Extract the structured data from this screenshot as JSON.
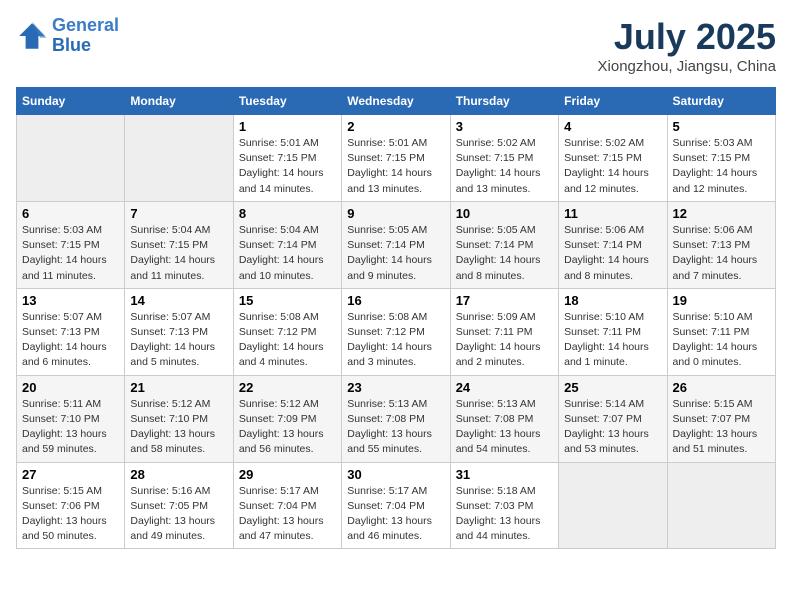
{
  "header": {
    "logo_line1": "General",
    "logo_line2": "Blue",
    "month": "July 2025",
    "location": "Xiongzhou, Jiangsu, China"
  },
  "weekdays": [
    "Sunday",
    "Monday",
    "Tuesday",
    "Wednesday",
    "Thursday",
    "Friday",
    "Saturday"
  ],
  "weeks": [
    [
      {
        "day": "",
        "info": ""
      },
      {
        "day": "",
        "info": ""
      },
      {
        "day": "1",
        "info": "Sunrise: 5:01 AM\nSunset: 7:15 PM\nDaylight: 14 hours\nand 14 minutes."
      },
      {
        "day": "2",
        "info": "Sunrise: 5:01 AM\nSunset: 7:15 PM\nDaylight: 14 hours\nand 13 minutes."
      },
      {
        "day": "3",
        "info": "Sunrise: 5:02 AM\nSunset: 7:15 PM\nDaylight: 14 hours\nand 13 minutes."
      },
      {
        "day": "4",
        "info": "Sunrise: 5:02 AM\nSunset: 7:15 PM\nDaylight: 14 hours\nand 12 minutes."
      },
      {
        "day": "5",
        "info": "Sunrise: 5:03 AM\nSunset: 7:15 PM\nDaylight: 14 hours\nand 12 minutes."
      }
    ],
    [
      {
        "day": "6",
        "info": "Sunrise: 5:03 AM\nSunset: 7:15 PM\nDaylight: 14 hours\nand 11 minutes."
      },
      {
        "day": "7",
        "info": "Sunrise: 5:04 AM\nSunset: 7:15 PM\nDaylight: 14 hours\nand 11 minutes."
      },
      {
        "day": "8",
        "info": "Sunrise: 5:04 AM\nSunset: 7:14 PM\nDaylight: 14 hours\nand 10 minutes."
      },
      {
        "day": "9",
        "info": "Sunrise: 5:05 AM\nSunset: 7:14 PM\nDaylight: 14 hours\nand 9 minutes."
      },
      {
        "day": "10",
        "info": "Sunrise: 5:05 AM\nSunset: 7:14 PM\nDaylight: 14 hours\nand 8 minutes."
      },
      {
        "day": "11",
        "info": "Sunrise: 5:06 AM\nSunset: 7:14 PM\nDaylight: 14 hours\nand 8 minutes."
      },
      {
        "day": "12",
        "info": "Sunrise: 5:06 AM\nSunset: 7:13 PM\nDaylight: 14 hours\nand 7 minutes."
      }
    ],
    [
      {
        "day": "13",
        "info": "Sunrise: 5:07 AM\nSunset: 7:13 PM\nDaylight: 14 hours\nand 6 minutes."
      },
      {
        "day": "14",
        "info": "Sunrise: 5:07 AM\nSunset: 7:13 PM\nDaylight: 14 hours\nand 5 minutes."
      },
      {
        "day": "15",
        "info": "Sunrise: 5:08 AM\nSunset: 7:12 PM\nDaylight: 14 hours\nand 4 minutes."
      },
      {
        "day": "16",
        "info": "Sunrise: 5:08 AM\nSunset: 7:12 PM\nDaylight: 14 hours\nand 3 minutes."
      },
      {
        "day": "17",
        "info": "Sunrise: 5:09 AM\nSunset: 7:11 PM\nDaylight: 14 hours\nand 2 minutes."
      },
      {
        "day": "18",
        "info": "Sunrise: 5:10 AM\nSunset: 7:11 PM\nDaylight: 14 hours\nand 1 minute."
      },
      {
        "day": "19",
        "info": "Sunrise: 5:10 AM\nSunset: 7:11 PM\nDaylight: 14 hours\nand 0 minutes."
      }
    ],
    [
      {
        "day": "20",
        "info": "Sunrise: 5:11 AM\nSunset: 7:10 PM\nDaylight: 13 hours\nand 59 minutes."
      },
      {
        "day": "21",
        "info": "Sunrise: 5:12 AM\nSunset: 7:10 PM\nDaylight: 13 hours\nand 58 minutes."
      },
      {
        "day": "22",
        "info": "Sunrise: 5:12 AM\nSunset: 7:09 PM\nDaylight: 13 hours\nand 56 minutes."
      },
      {
        "day": "23",
        "info": "Sunrise: 5:13 AM\nSunset: 7:08 PM\nDaylight: 13 hours\nand 55 minutes."
      },
      {
        "day": "24",
        "info": "Sunrise: 5:13 AM\nSunset: 7:08 PM\nDaylight: 13 hours\nand 54 minutes."
      },
      {
        "day": "25",
        "info": "Sunrise: 5:14 AM\nSunset: 7:07 PM\nDaylight: 13 hours\nand 53 minutes."
      },
      {
        "day": "26",
        "info": "Sunrise: 5:15 AM\nSunset: 7:07 PM\nDaylight: 13 hours\nand 51 minutes."
      }
    ],
    [
      {
        "day": "27",
        "info": "Sunrise: 5:15 AM\nSunset: 7:06 PM\nDaylight: 13 hours\nand 50 minutes."
      },
      {
        "day": "28",
        "info": "Sunrise: 5:16 AM\nSunset: 7:05 PM\nDaylight: 13 hours\nand 49 minutes."
      },
      {
        "day": "29",
        "info": "Sunrise: 5:17 AM\nSunset: 7:04 PM\nDaylight: 13 hours\nand 47 minutes."
      },
      {
        "day": "30",
        "info": "Sunrise: 5:17 AM\nSunset: 7:04 PM\nDaylight: 13 hours\nand 46 minutes."
      },
      {
        "day": "31",
        "info": "Sunrise: 5:18 AM\nSunset: 7:03 PM\nDaylight: 13 hours\nand 44 minutes."
      },
      {
        "day": "",
        "info": ""
      },
      {
        "day": "",
        "info": ""
      }
    ]
  ]
}
